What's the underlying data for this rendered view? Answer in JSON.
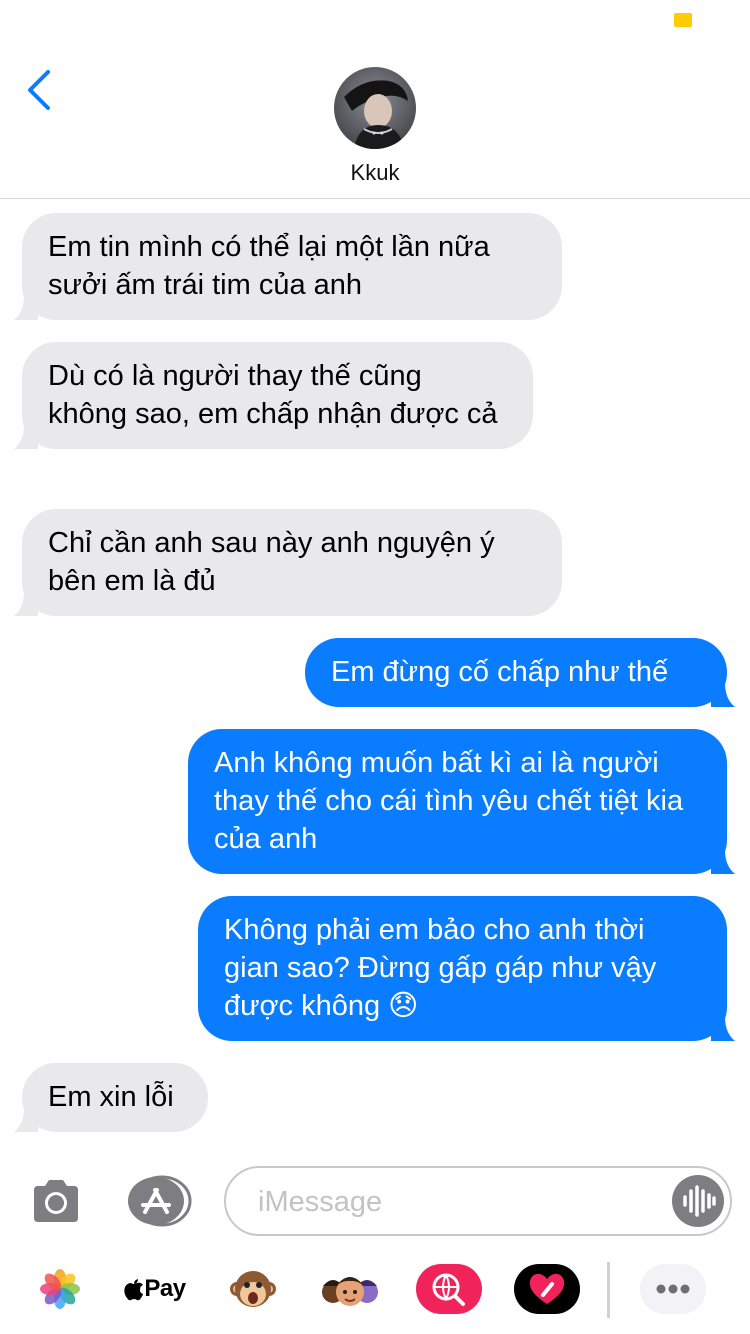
{
  "contact": {
    "name": "Kkuk"
  },
  "messages": [
    {
      "direction": "in",
      "text": "Em tin mình có thể lại một lần nữa sưởi ấm trái tim của anh"
    },
    {
      "direction": "in",
      "text": "Dù có là người thay thế cũng không sao, em chấp nhận được cả"
    },
    {
      "direction": "in",
      "text": "Chỉ cần anh sau này anh nguyện ý bên em là đủ"
    },
    {
      "direction": "out",
      "text": "Em đừng cố chấp như thế"
    },
    {
      "direction": "out",
      "text": "Anh không muốn bất kì ai là người thay thế cho cái tình yêu chết tiệt kia của anh"
    },
    {
      "direction": "out",
      "text": "Không phải em bảo cho anh thời gian sao? Đừng gấp gáp như vậy được không 😞"
    },
    {
      "direction": "in",
      "text": "Em xin lỗi"
    }
  ],
  "composer": {
    "placeholder": "iMessage"
  },
  "app_strip": {
    "apple_pay_label": "Pay"
  },
  "colors": {
    "incoming_bubble": "#e9e9eb",
    "outgoing_bubble": "#0a7cff",
    "accent": "#0a7cff"
  }
}
